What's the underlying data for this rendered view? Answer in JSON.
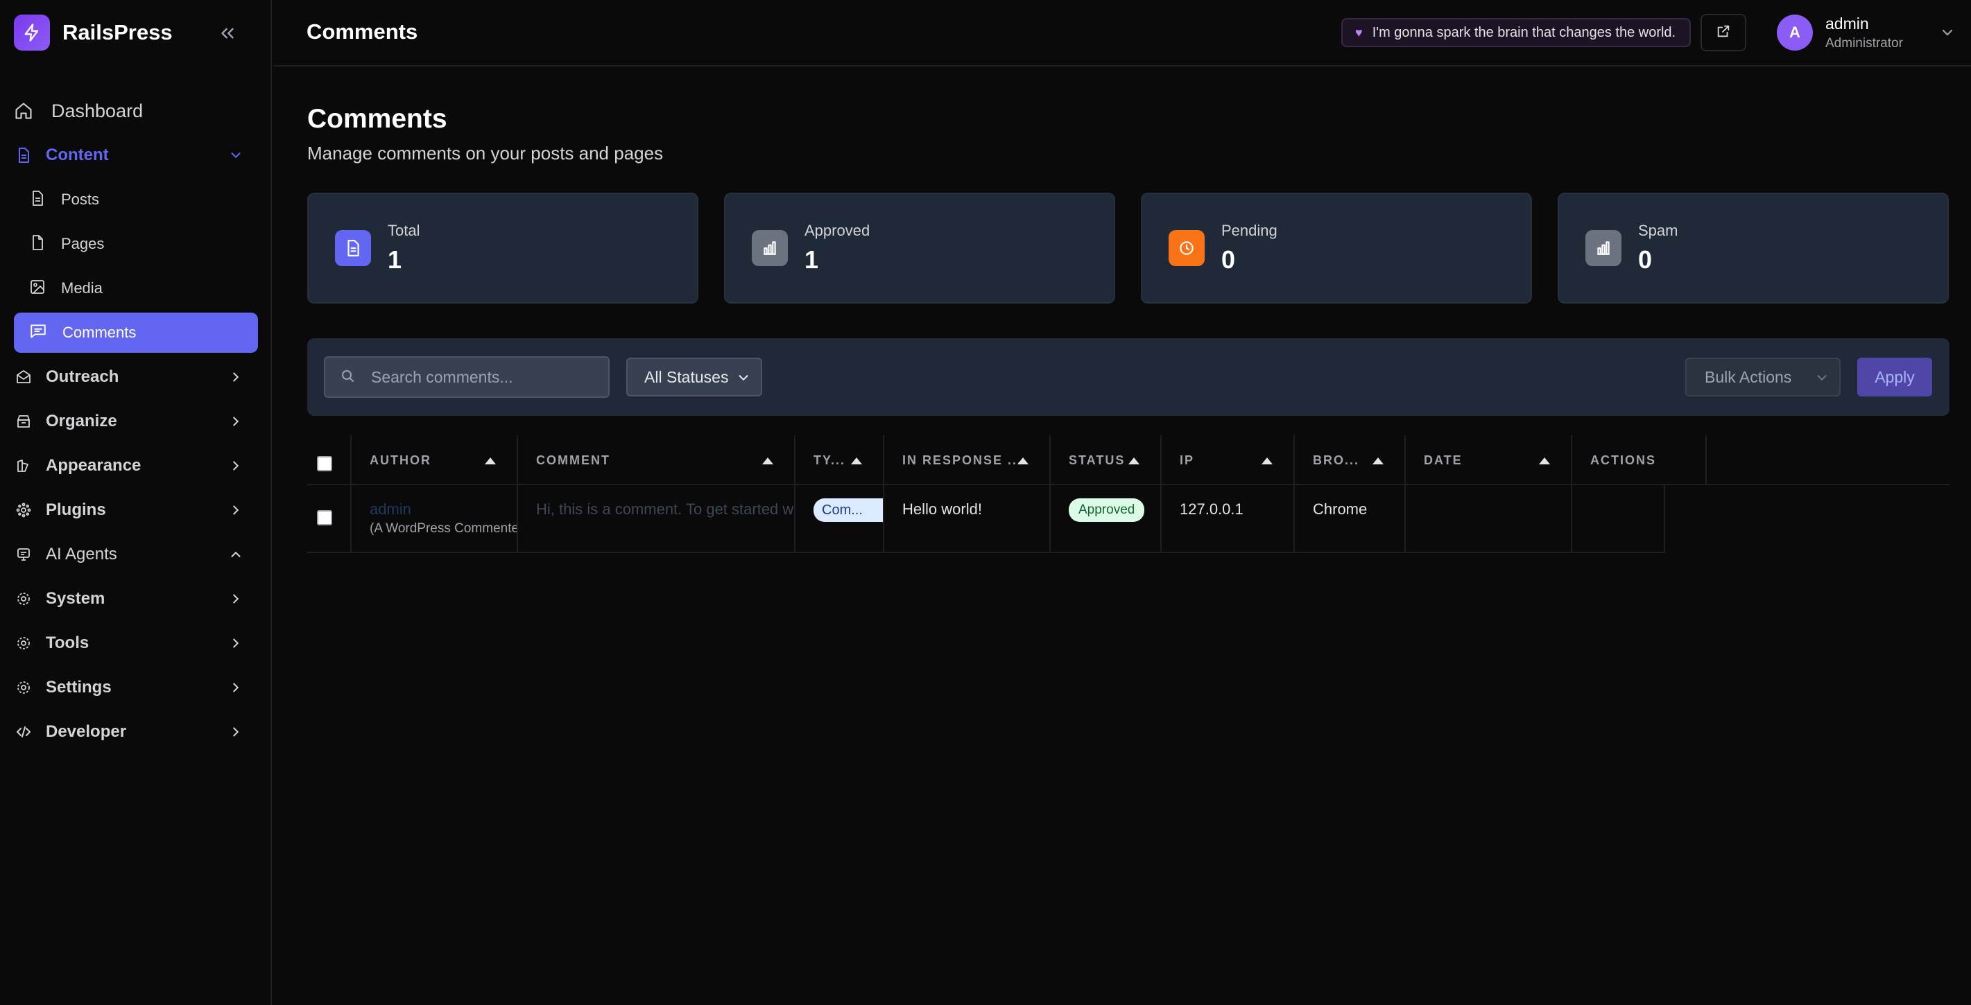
{
  "app": {
    "name": "RailsPress"
  },
  "header": {
    "title": "Comments",
    "quote": "I'm gonna spark the brain that changes the world.",
    "user": {
      "avatar_initial": "A",
      "name": "admin",
      "role": "Administrator"
    }
  },
  "sidebar": {
    "dashboard": "Dashboard",
    "content": "Content",
    "content_items": [
      "Posts",
      "Pages",
      "Media",
      "Comments"
    ],
    "sections": [
      "Outreach",
      "Organize",
      "Appearance",
      "Plugins",
      "AI Agents",
      "System",
      "Tools",
      "Settings",
      "Developer"
    ]
  },
  "page": {
    "title": "Comments",
    "subtitle": "Manage comments on your posts and pages"
  },
  "stats": [
    {
      "label": "Total",
      "value": "1",
      "color": "#6366f1"
    },
    {
      "label": "Approved",
      "value": "1",
      "color": "#6b7280"
    },
    {
      "label": "Pending",
      "value": "0",
      "color": "#f97316"
    },
    {
      "label": "Spam",
      "value": "0",
      "color": "#6b7280"
    }
  ],
  "toolbar": {
    "search_placeholder": "Search comments...",
    "status_filter": "All Statuses",
    "bulk_actions": "Bulk Actions",
    "apply": "Apply"
  },
  "table": {
    "columns": [
      "AUTHOR",
      "COMMENT",
      "TY...",
      "IN RESPONSE ...",
      "STATUS",
      "IP",
      "BRO...",
      "DATE",
      "ACTIONS"
    ],
    "rows": [
      {
        "author": "admin",
        "author_sub": "(A WordPress Commenter)",
        "comment": "Hi, this is a comment. To get started with moderating",
        "type": "Com...",
        "in_response": "Hello world!",
        "status": "Approved",
        "ip": "127.0.0.1",
        "browser": "Chrome",
        "date": "",
        "actions": ""
      }
    ]
  },
  "colors": {
    "accent": "#6366f1",
    "background": "#0a0a0a",
    "card": "#1f2937"
  }
}
